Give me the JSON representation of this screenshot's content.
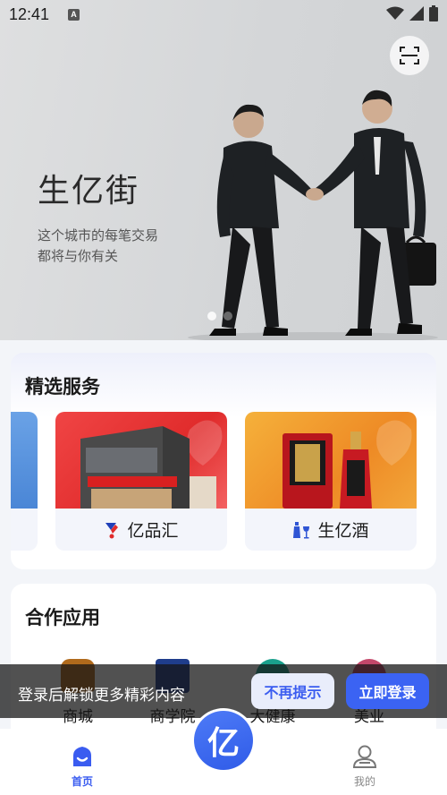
{
  "status_bar": {
    "time": "12:41",
    "notification_letter": "A"
  },
  "hero": {
    "title": "生亿街",
    "subtitle_line1": "这个城市的每笔交易",
    "subtitle_line2": "都将与你有关",
    "scan_icon": "scan-icon",
    "carousel_active_index": 0,
    "carousel_count": 2
  },
  "services": {
    "title": "精选服务",
    "items": [
      {
        "label": "亿品汇",
        "icon": "yipinhui-logo-icon"
      },
      {
        "label": "生亿酒",
        "icon": "liquor-bottle-icon"
      }
    ]
  },
  "apps": {
    "title": "合作应用",
    "items": [
      {
        "label": "商城",
        "icon": "shopping-bag-icon",
        "color": "#b06a1c"
      },
      {
        "label": "商学院",
        "icon": "graduation-cap-icon",
        "color": "#1f3d8c"
      },
      {
        "label": "大健康",
        "icon": "health-heart-icon",
        "color": "#1aa08c"
      },
      {
        "label": "美业",
        "icon": "beauty-flower-icon",
        "color": "#c4476a"
      }
    ]
  },
  "login_banner": {
    "text": "登录后解锁更多精彩内容",
    "dismiss_label": "不再提示",
    "login_label": "立即登录"
  },
  "bottom_nav": {
    "home_label": "首页",
    "center_glyph": "亿",
    "me_label": "我的",
    "active": "home"
  },
  "colors": {
    "accent": "#3b63f3",
    "service_red": "#e02b2b",
    "service_orange": "#ee8a25"
  }
}
